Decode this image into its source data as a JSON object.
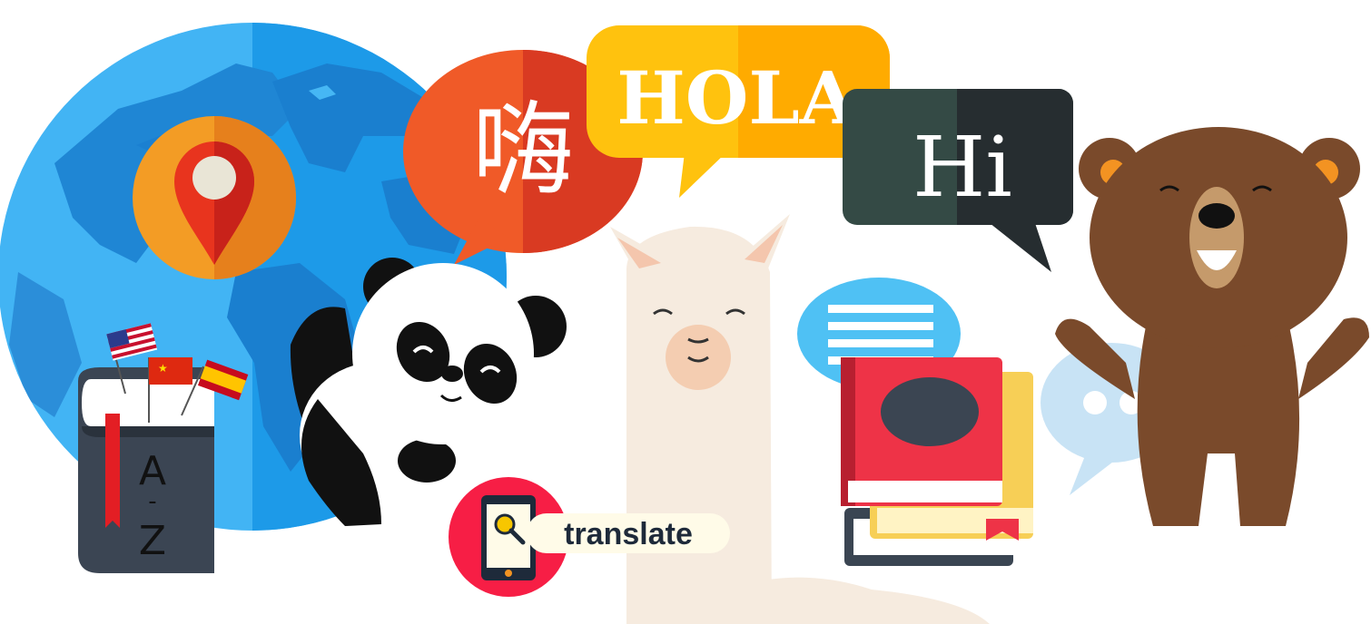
{
  "bubbles": {
    "chinese": {
      "text": "嗨",
      "color": "#f05a28"
    },
    "spanish": {
      "text": "HOLA",
      "color": "#ffc20e"
    },
    "english": {
      "text": "Hi",
      "color": "#2e3d3b"
    }
  },
  "dictionary": {
    "top_letter": "A",
    "bottom_letter": "Z",
    "separator": "-"
  },
  "translate_badge": {
    "label": "translate"
  },
  "flags": [
    "usa-flag",
    "china-flag",
    "spain-flag"
  ],
  "characters": [
    "panda",
    "alpaca",
    "bear"
  ],
  "colors": {
    "globe_light": "#2fa9f0",
    "globe_dark": "#1c98e8",
    "land": "#2f86d6",
    "panda": "#111111",
    "alpaca": "#f6ebdf",
    "bear": "#7a4a2b",
    "book_red": "#ee3347",
    "pin_orange": "#f39322"
  }
}
